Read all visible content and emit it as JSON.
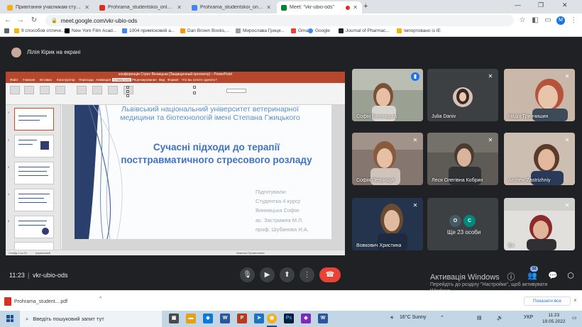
{
  "browser": {
    "tabs": [
      {
        "title": "Привітання учасникам студент",
        "favicon_color": "#f2b01e"
      },
      {
        "title": "Prohrama_studentskoi_onlain-ko",
        "favicon_color": "#d93025"
      },
      {
        "title": "Prohrama_studentskoi_onlain-ko",
        "favicon_color": "#4285f4"
      },
      {
        "title": "Meet: \"vkr-ubio-ods\"",
        "favicon_color": "#00832d",
        "active": true
      }
    ],
    "new_tab": "+",
    "url": "meet.google.com/vkr-ubio-ods",
    "profile_initial": "M",
    "bookmarks": [
      {
        "label": "",
        "icon_color": "#5f6368"
      },
      {
        "label": "9 способов отличи...",
        "icon_color": "#f4b400"
      },
      {
        "label": "New York Film Acad...",
        "icon_color": "#000000"
      },
      {
        "label": "1004 примісковий а...",
        "icon_color": "#4285f4"
      },
      {
        "label": "Dan Brown Books,...",
        "icon_color": "#ff9900"
      },
      {
        "label": "Мирослава Гриця...",
        "icon_color": "#9aa0a6"
      },
      {
        "label": "Gmail",
        "icon_color": "#ea4335"
      },
      {
        "label": "Google",
        "icon_color": "#4285f4"
      },
      {
        "label": "Journal of Pharmac...",
        "icon_color": "#202124"
      },
      {
        "label": "Імпортовано із IE",
        "icon_color": "#f4b400"
      }
    ]
  },
  "meet": {
    "presenting_label": "Лілія Кірик на екрані",
    "time": "11:23",
    "divider": "|",
    "meeting_code": "vkr-ubio-ods",
    "people_count": "32",
    "participants": [
      {
        "name": "Софія Винницька",
        "mic": "speaking"
      },
      {
        "name": "Julia Daniv",
        "mic": "muted"
      },
      {
        "name": "Надія Гринчишин",
        "mic": "muted"
      },
      {
        "name": "Софія Петрищук",
        "mic": "muted"
      },
      {
        "name": "Леся Олегівна Кобрин",
        "mic": "muted"
      },
      {
        "name": "Andrew Zastrizhniy",
        "mic": "muted"
      },
      {
        "name": "Вовкович Христина",
        "mic": "muted"
      },
      {
        "name": "Ще 23 особи",
        "initials": [
          "О",
          "С"
        ],
        "mic": "none"
      },
      {
        "name": "Ви",
        "mic": "muted"
      }
    ],
    "windows_activation": {
      "title": "Активація Windows",
      "line1": "Перейдіть до розділу \"Настройки\", щоб активувати",
      "line2": "Windows."
    }
  },
  "presentation": {
    "app_title": "конференція Стрес Вінницька [Защищенный просмотр] – PowerPoint",
    "menu": [
      "Файл",
      "Главная",
      "Вставка",
      "Конструктор",
      "Переходы",
      "Анимация",
      "Слайд-шоу",
      "Рецензирование",
      "Вид",
      "Формат",
      "Что вы хотите сделать?"
    ],
    "slide": {
      "header_line1": "Львівський національний університет ветеринарної",
      "header_line2": "медицини та біотехнологій імені Степана Гжицького",
      "title_line1": "Сучасні підходи до терапії",
      "title_line2": "посттравматичного стресового розладу",
      "prepared": [
        "Підготували:",
        "Студентка 4 курсу",
        "Винницька Софія",
        "ас. Застрижна М.Л.",
        "проф. Шубанова Н.А."
      ]
    },
    "status_left": "Слайд 1 из 21",
    "status_lang": "украинский",
    "status_right": "Заметки   Примечания"
  },
  "downloads": {
    "file": "Prohrama_student....pdf",
    "chevron": "^",
    "show_all": "Показати все",
    "close": "×"
  },
  "taskbar": {
    "search_placeholder": "Введіть пошуковий запит тут",
    "weather": "16°C  Sunny",
    "lang": "УКР",
    "time": "11:23",
    "date": "19.05.2022"
  },
  "colors": {
    "meet_bg": "#202124",
    "end_call": "#ea4335",
    "speaking": "#1a73e8",
    "powerpoint": "#b7472a",
    "slide_title": "#3f72c4"
  }
}
